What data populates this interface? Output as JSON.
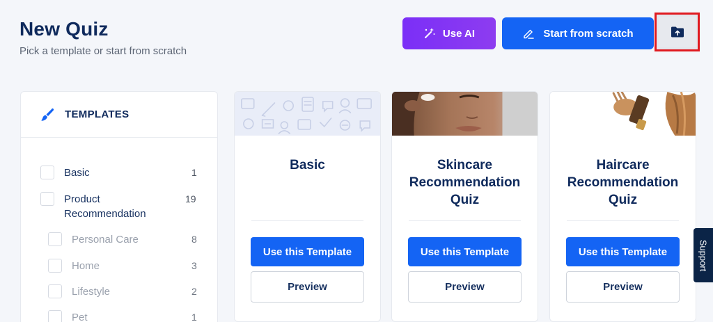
{
  "header": {
    "title": "New Quiz",
    "subtitle": "Pick a template or start from scratch",
    "use_ai_label": "Use AI",
    "start_scratch_label": "Start from scratch"
  },
  "sidebar": {
    "heading": "TEMPLATES",
    "categories": [
      {
        "name": "Basic",
        "count": "1"
      },
      {
        "name": "Product Recommendation",
        "count": "19"
      },
      {
        "name": "Personal Care",
        "count": "8"
      },
      {
        "name": "Home",
        "count": "3"
      },
      {
        "name": "Lifestyle",
        "count": "2"
      },
      {
        "name": "Pet",
        "count": "1"
      }
    ]
  },
  "cards": [
    {
      "title": "Basic",
      "use_label": "Use this Template",
      "preview_label": "Preview"
    },
    {
      "title": "Skincare Recommendation Quiz",
      "use_label": "Use this Template",
      "preview_label": "Preview"
    },
    {
      "title": "Haircare Recommendation Quiz",
      "use_label": "Use this Template",
      "preview_label": "Preview"
    }
  ],
  "support_label": "Support",
  "colors": {
    "primary": "#1464f4",
    "ai_purple": "#7b2ff7",
    "navy": "#0f2a5c",
    "highlight_red": "#e0191f"
  }
}
